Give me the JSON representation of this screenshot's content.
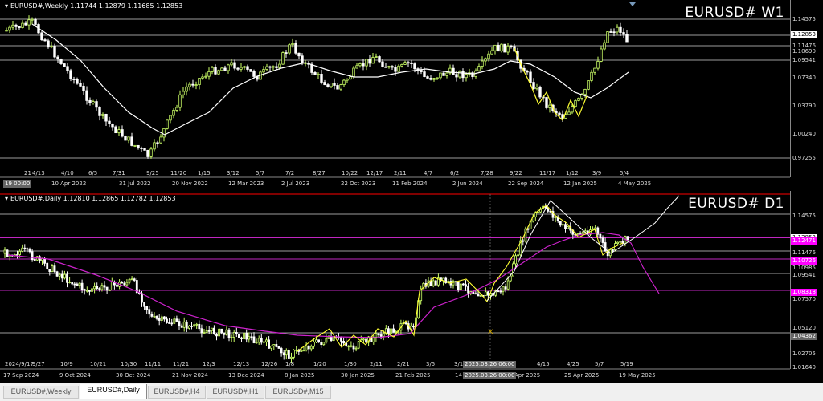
{
  "top_chart": {
    "info": "EURUSD#,Weekly  1.11744 1.12879 1.11685 1.12853",
    "title": "EURUSD# W1",
    "price_labels": [
      "1.14575",
      "1.12853",
      "1.11476",
      "1.10690",
      "1.09541",
      "1.07340",
      "1.03790",
      "1.00240",
      "0.97255"
    ],
    "time_labels": [
      "21",
      "4/13",
      "4/10",
      "10 Apr 2022",
      "6/5",
      "7/31",
      "31 Jul 2022",
      "9/25",
      "11/20",
      "20 Nov 2022",
      "1/15",
      "3/12",
      "12 Mar 2023",
      "5/7",
      "7/2",
      "2 Jul 2023",
      "8/27",
      "10/22",
      "22 Oct 2023",
      "12/17",
      "2/11",
      "11 Feb 2024",
      "4/7",
      "6/2",
      "2 Jun 2024",
      "7/28",
      "9/22",
      "22 Sep 2024",
      "11/17",
      "1/12",
      "12 Jan 2025",
      "3/9",
      "5/4",
      "4 May 2025"
    ],
    "cursor_label": "19 00:00"
  },
  "bottom_chart": {
    "info": "EURUSD#,Daily  1.12810 1.12865 1.12782 1.12853",
    "title": "EURUSD# D1",
    "price_labels": [
      "1.14575",
      "1.12853",
      "1.12471",
      "1.11476",
      "1.10985",
      "1.10726",
      "1.09541",
      "1.08318",
      "1.07570",
      "1.05120",
      "1.04362",
      "1.02705",
      "1.01640"
    ],
    "time_labels": [
      "2024/9/17",
      "9/27",
      "17 Sep 2024",
      "10/9",
      "9 Oct 2024",
      "10/21",
      "10/30",
      "30 Oct 2024",
      "11/11",
      "11/21",
      "21 Nov 2024",
      "12/3",
      "12/13",
      "13 Dec 2024",
      "12/26",
      "1/8",
      "8 Jan 2025",
      "1/20",
      "1/30",
      "30 Jan 2025",
      "2/11",
      "2/21",
      "21 Feb 2025",
      "3/5",
      "3/1",
      "14",
      "4/15",
      "Apr 2025",
      "4/25",
      "25 Apr 2025",
      "5/7",
      "5/19",
      "19 May 2025"
    ],
    "cursor_time_1": "2025.03.26 06:00",
    "cursor_time_2": "2025.03.26 00:00"
  },
  "tabs": [
    {
      "label": "EURUSD#,Weekly",
      "active": false
    },
    {
      "label": "EURUSD#,Daily",
      "active": true
    },
    {
      "label": "EURUSD#,H4",
      "active": false
    },
    {
      "label": "EURUSD#,H1",
      "active": false
    },
    {
      "label": "EURUSD#,M15",
      "active": false
    }
  ],
  "colors": {
    "bull_candle": "#ccff66",
    "bear_candle": "#ffffff",
    "ma_weekly": "#ffffff",
    "ma_daily": "#cc22cc",
    "level_magenta": "#ff33ff",
    "price_tag_magenta": "#ff00ff"
  }
}
